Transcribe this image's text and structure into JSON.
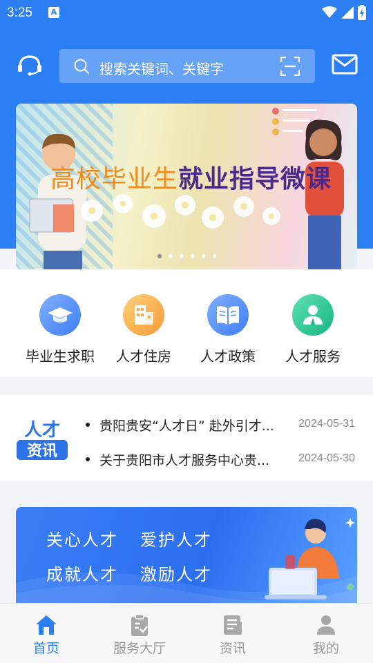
{
  "status": {
    "time": "3:25",
    "notif_letter": "A"
  },
  "search": {
    "placeholder": "搜索关键词、关键字"
  },
  "banner": {
    "title_part1": "高校毕业生",
    "title_part2": "就业指导微课",
    "slides": 6,
    "active": 0
  },
  "quick_links": [
    {
      "label": "毕业生求职",
      "icon": "graduation-cap-icon",
      "color": "#4d8ff5"
    },
    {
      "label": "人才住房",
      "icon": "building-icon",
      "color": "#f6a94a"
    },
    {
      "label": "人才政策",
      "icon": "book-icon",
      "color": "#4d8ff5"
    },
    {
      "label": "人才服务",
      "icon": "person-service-icon",
      "color": "#20c38e"
    }
  ],
  "news": {
    "logo_line1": "人才",
    "logo_line2": "资讯",
    "items": [
      {
        "title": "贵阳贵安“人才日” 赴外引才...",
        "date": "2024-05-31"
      },
      {
        "title": "关于贵阳市人才服务中心贵...",
        "date": "2024-05-30"
      }
    ]
  },
  "promo": {
    "line1a": "关心人才",
    "line1b": "爱护人才",
    "line2a": "成就人才",
    "line2b": "激励人才"
  },
  "tabs": [
    {
      "label": "首页",
      "icon": "home-icon"
    },
    {
      "label": "服务大厅",
      "icon": "clipboard-icon"
    },
    {
      "label": "资讯",
      "icon": "news-icon"
    },
    {
      "label": "我的",
      "icon": "user-icon"
    }
  ],
  "colors": {
    "primary": "#2b7ff2"
  }
}
